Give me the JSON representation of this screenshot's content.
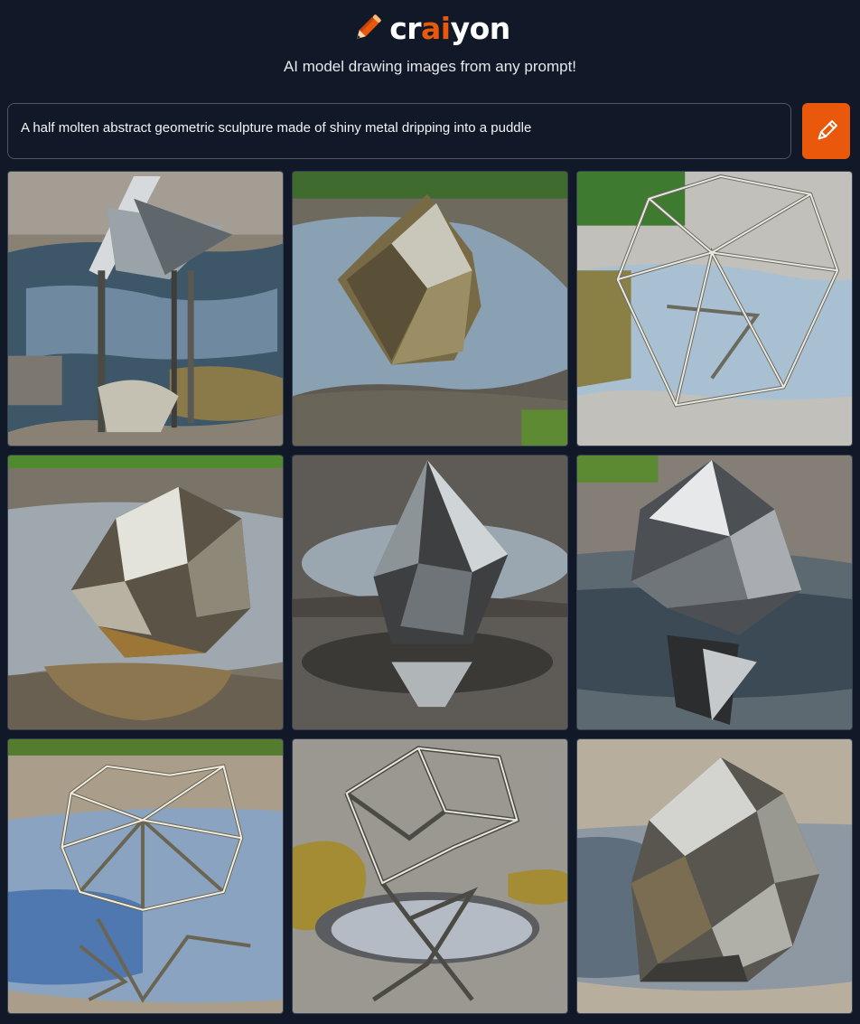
{
  "app": {
    "logo_prefix": "cr",
    "logo_accent": "ai",
    "logo_suffix": "yon",
    "tagline": "AI model drawing images from any prompt!",
    "icon": "pencil-icon",
    "accent_color": "#ea580c"
  },
  "prompt": {
    "value": "A half molten abstract geometric sculpture made of shiny metal dripping into a puddle",
    "button_icon": "pencil-icon"
  },
  "results": [
    {
      "description": "metal sculpture dripping into puddle 1"
    },
    {
      "description": "metal sculpture dripping into puddle 2"
    },
    {
      "description": "metal sculpture dripping into puddle 3"
    },
    {
      "description": "metal sculpture dripping into puddle 4"
    },
    {
      "description": "metal sculpture dripping into puddle 5"
    },
    {
      "description": "metal sculpture dripping into puddle 6"
    },
    {
      "description": "metal sculpture dripping into puddle 7"
    },
    {
      "description": "metal sculpture dripping into puddle 8"
    },
    {
      "description": "metal sculpture dripping into puddle 9"
    }
  ]
}
